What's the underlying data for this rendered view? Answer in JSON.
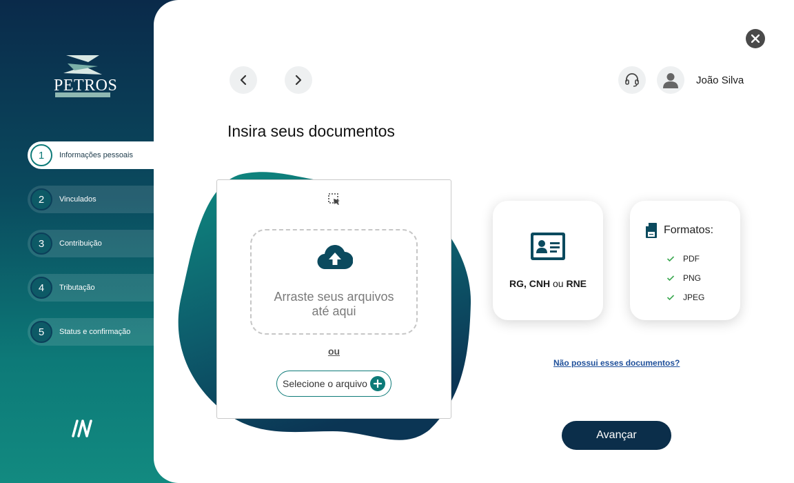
{
  "brand": {
    "logo_text": "PETROS"
  },
  "steps": [
    {
      "number": "1",
      "label": "Informações pessoais",
      "active": true
    },
    {
      "number": "2",
      "label": "Vinculados",
      "active": false
    },
    {
      "number": "3",
      "label": "Contribuição",
      "active": false
    },
    {
      "number": "4",
      "label": "Tributação",
      "active": false
    },
    {
      "number": "5",
      "label": "Status e confirmação",
      "active": false
    }
  ],
  "header": {
    "user_name": "João Silva"
  },
  "page": {
    "title": "Insira seus documentos"
  },
  "upload": {
    "drop_text_line1": "Arraste seus arquivos",
    "drop_text_line2": "até aqui",
    "or_label": "ou",
    "select_button_label": "Selecione o arquivo"
  },
  "documents_card": {
    "doc1": "RG,",
    "doc2": "CNH",
    "connector": "ou",
    "doc3": "RNE"
  },
  "formats_card": {
    "title": "Formatos:",
    "items": [
      "PDF",
      "PNG",
      "JPEG"
    ]
  },
  "no_documents_link": "Não possui esses documentos?",
  "next_button_label": "Avançar",
  "colors": {
    "navy": "#0b2e4a",
    "teal": "#0d7a78",
    "link": "#1e4f9a",
    "check": "#3aa850"
  },
  "icons": [
    "close-icon",
    "chevron-left-icon",
    "chevron-right-icon",
    "headset-icon",
    "user-icon",
    "select-area-icon",
    "cloud-upload-icon",
    "plus-icon",
    "id-card-icon",
    "document-icon",
    "check-icon",
    "brand-mark-icon"
  ]
}
